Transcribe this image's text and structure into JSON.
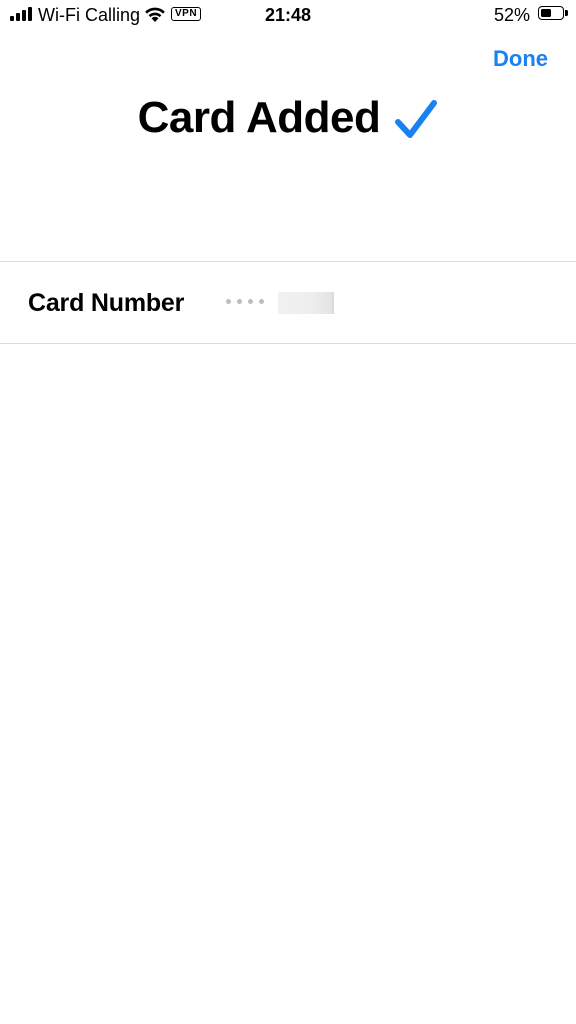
{
  "status_bar": {
    "carrier": "Wi-Fi Calling",
    "vpn": "VPN",
    "time": "21:48",
    "battery_percent": "52%",
    "battery_level": 0.52,
    "icons": [
      "signal-icon",
      "wifi-icon",
      "battery-icon"
    ]
  },
  "nav": {
    "done_label": "Done",
    "accent_color": "#1a82f0"
  },
  "header": {
    "title": "Card Added",
    "check_icon": "checkmark-icon"
  },
  "card": {
    "label": "Card Number",
    "masked_digits": "••••"
  }
}
